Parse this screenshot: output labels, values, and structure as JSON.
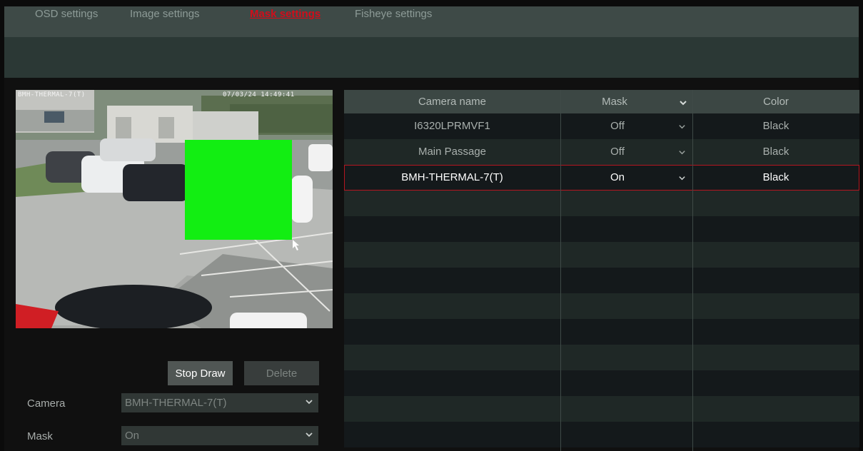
{
  "tabs": [
    {
      "label": "OSD settings",
      "active": false
    },
    {
      "label": "Image settings",
      "active": false
    },
    {
      "label": "Mask settings",
      "active": true
    },
    {
      "label": "Fisheye settings",
      "active": false
    }
  ],
  "preview": {
    "osd_camera_name": "BMH-THERMAL-7(T)",
    "osd_datetime": "07/03/24 14:49:41",
    "mask_color": "#12ee12"
  },
  "buttons": {
    "stop_draw": "Stop Draw",
    "delete": "Delete"
  },
  "form": {
    "camera_label": "Camera",
    "camera_value": "BMH-THERMAL-7(T)",
    "mask_label": "Mask",
    "mask_value": "On"
  },
  "table": {
    "columns": [
      "Camera name",
      "Mask",
      "Color"
    ],
    "rows": [
      {
        "camera_name": "I6320LPRMVF1",
        "mask": "Off",
        "color": "Black",
        "selected": false
      },
      {
        "camera_name": "Main Passage",
        "mask": "Off",
        "color": "Black",
        "selected": false
      },
      {
        "camera_name": "BMH-THERMAL-7(T)",
        "mask": "On",
        "color": "Black",
        "selected": true
      }
    ]
  },
  "colors": {
    "active_tab": "#d20d1a",
    "selected_row_border": "#b41620",
    "tab_bar": "#3e4a47"
  },
  "icons": {
    "dropdown": "chevron-down-icon"
  }
}
